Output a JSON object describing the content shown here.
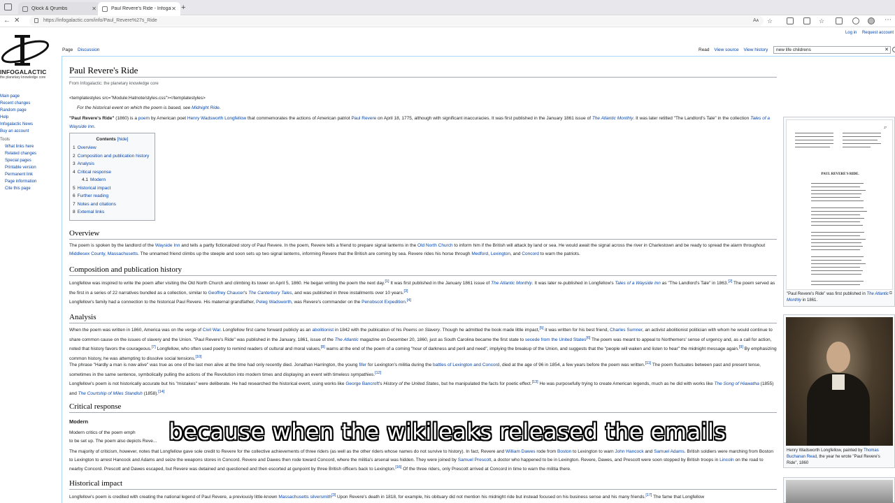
{
  "browser": {
    "tabs": [
      {
        "title": "Qlock & Qrumbs",
        "close": "✕"
      },
      {
        "title": "Paul Revere's Ride - Infogalactic",
        "close": "✕"
      }
    ],
    "new_tab": "+",
    "url": "https://infogalactic.com/info/Paul_Revere%27s_Ride",
    "reader_label": "Aᴀ"
  },
  "site": {
    "logo_text": "INFOGALACTIC",
    "logo_tagline": "the planetary knowledge core",
    "user_links": [
      "Log in",
      "Request account"
    ],
    "page_tabs": [
      "Page",
      "Discussion"
    ],
    "actions": [
      "Read",
      "View source",
      "View history"
    ],
    "search_value": "new life childrens",
    "sidebar": {
      "nav": [
        "Main page",
        "Recent changes",
        "Random page",
        "Help",
        "Infogalactic News",
        "Buy an account"
      ],
      "tools_heading": "Tools",
      "tools": [
        "What links here",
        "Related changes",
        "Special pages",
        "Printable version",
        "Permanent link",
        "Page information",
        "Cite this page"
      ]
    }
  },
  "article": {
    "title": "Paul Revere's Ride",
    "from": "From Infogalactic: the planetary knowledge core",
    "templatestyles": "<templatestyles src=\"Module:Hatnote/styles.css\"></templatestyles>",
    "hatnote": {
      "prefix": "For the historical event on which the poem is based, see ",
      "link": "Midnight Ride",
      "suffix": "."
    },
    "intro": {
      "t1": "\"Paul Revere's Ride\"",
      "t2": " (1860) is a ",
      "l1": "poem",
      "t3": " by American poet ",
      "l2": "Henry Wadsworth Longfellow",
      "t4": " that commemorates the actions of American patriot ",
      "l3": "Paul Revere",
      "t5": " on April 18, 1775, although with significant inaccuracies. It was first published in the January 1861 issue of ",
      "l4": "The Atlantic Monthly",
      "t6": ". It was later retitled \"The Landlord's Tale\" in the collection ",
      "l5": "Tales of a Wayside Inn",
      "t7": "."
    },
    "toc": {
      "title": "Contents",
      "hide": "[hide]",
      "items": [
        {
          "num": "1",
          "label": "Overview"
        },
        {
          "num": "2",
          "label": "Composition and publication history"
        },
        {
          "num": "3",
          "label": "Analysis"
        },
        {
          "num": "4",
          "label": "Critical response"
        },
        {
          "num": "4.1",
          "label": "Modern"
        },
        {
          "num": "5",
          "label": "Historical impact"
        },
        {
          "num": "6",
          "label": "Further reading"
        },
        {
          "num": "7",
          "label": "Notes and citations"
        },
        {
          "num": "8",
          "label": "External links"
        }
      ]
    },
    "overview": {
      "heading": "Overview",
      "t1": "The poem is spoken by the landlord of the ",
      "l1": "Wayside Inn",
      "t2": " and tells a partly fictionalized story of Paul Revere. In the poem, Revere tells a friend to prepare signal lanterns in the ",
      "l2": "Old North Church",
      "t3": " to inform him if the British will attack by land or sea. He would await the signal across the river in Charlestown and be ready to spread the alarm throughout ",
      "l3": "Middlesex County, Massachusetts",
      "t4": ". The unnamed friend climbs up the steeple and soon sets up two signal lanterns, informing Revere that the British are coming by sea. Revere rides his horse through ",
      "l4": "Medford",
      "t5": ", ",
      "l5": "Lexington",
      "t6": ", and ",
      "l6": "Concord",
      "t7": " to warn the patriots."
    },
    "composition": {
      "heading": "Composition and publication history",
      "p1": {
        "t1": "Longfellow was inspired to write the poem after visiting the Old North Church and climbing its tower on April 5, 1860. He began writing the poem the next day.",
        "r1": "[1]",
        "t2": " It was first published in the January 1861 issue of ",
        "l1": "The Atlantic Monthly",
        "t3": ". It was later re-published in Longfellow's ",
        "l2": "Tales of a Wayside Inn",
        "t4": " as \"The Landlord's Tale\" in 1863.",
        "r2": "[2]",
        "t5": " The poem served as the first in a series of 22 narratives bundled as a collection, similar to ",
        "l3": "Geoffrey Chaucer",
        "t6": "'s ",
        "l4": "The Canterbury Tales",
        "t7": ", and was published in three installments over 10 years.",
        "r3": "[3]"
      },
      "p2": {
        "t1": "Longfellow's family had a connection to the historical Paul Revere. His maternal grandfather, ",
        "l1": "Peleg Wadsworth",
        "t2": ", was Revere's commander on the ",
        "l2": "Penobscot Expedition",
        "t3": ".",
        "r1": "[4]"
      }
    },
    "analysis": {
      "heading": "Analysis",
      "p1": {
        "t1": "When the poem was written in 1860, America was on the verge of ",
        "l1": "Civil War",
        "t2": ". Longfellow first came forward publicly as an ",
        "l2": "abolitionist",
        "t3": " in 1842 with the publication of his ",
        "i1": "Poems on Slavery",
        "t4": ". Though he admitted the book made little impact,",
        "r1": "[5]",
        "t5": " it was written for his best friend, ",
        "l3": "Charles Sumner",
        "t6": ", an activist abolitionist politician with whom he would continue to share common cause on the issues of slavery and the Union. \"Paul Revere's Ride\" was published in the January, 1861, issue of the ",
        "l4": "The Atlantic",
        "t7": " magazine on December 20, 1860, just as South Carolina became the first state to ",
        "l5": "secede from the United States",
        "r2": "[6]",
        "t8": " The poem was meant to appeal to Northerners' sense of urgency and, as a call for action, noted that history favors the courageous.",
        "r3": "[7]",
        "t9": " Longfellow, who often used poetry to remind readers of cultural and moral values,",
        "r4": "[8]",
        "t10": " warns at the end of the poem of a coming \"hour of darkness and peril and need\", implying the breakup of the Union, and suggests that the \"people will waken and listen to hear\" the midnight message again.",
        "r5": "[9]",
        "t11": " By emphasizing common history, he was attempting to dissolve social tensions.",
        "r6": "[10]"
      },
      "p2": {
        "t1": "The phrase \"Hardly a man is now alive\" was true as one of the last men alive at the time had only recently died. Jonathan Harrington, the young ",
        "l1": "fifer",
        "t2": " for Lexington's militia during the ",
        "l2": "battles of Lexington and Concord",
        "t3": ", died at the age of 96 in 1854, a few years before the poem was written.",
        "r1": "[11]",
        "t4": " The poem fluctuates between past and present tense, sometimes in the same sentence, symbolically pulling the actions of the Revolution into modern times and displaying an event with timeless sympathies.",
        "r2": "[12]"
      },
      "p3": {
        "t1": "Longfellow's poem is not historically accurate but his \"mistakes\" were deliberate. He had researched the historical event, using works like ",
        "l1": "George Bancroft",
        "t2": "'s ",
        "i1": "History of the United States",
        "t3": ", but he manipulated the facts for poetic effect.",
        "r1": "[13]",
        "t4": " He was purposefully trying to create American legends, much as he did with works like ",
        "l2": "The Song of Hiawatha",
        "t5": " (1855) and ",
        "l3": "The Courtship of Miles Standish",
        "t6": " (1858).",
        "r2": "[14]"
      }
    },
    "critical": {
      "heading": "Critical response",
      "subheading": "Modern",
      "p1": {
        "t1": "Modern critics of the poem emph",
        "t2": "to be set up. The poem also depicts Reve",
        "t3": "..."
      },
      "p2": {
        "t1": "The majority of criticism, however, notes that Longfellow gave sole credit to Revere for the collective achievements of three riders (as well as the other riders whose names do not survive to history). In fact, Revere and ",
        "l1": "William Dawes",
        "t2": " rode from ",
        "l2": "Boston",
        "t3": " to Lexington to warn ",
        "l3": "John Hancock",
        "t4": " and ",
        "l4": "Samuel Adams",
        "t5": ". British soldiers were marching from Boston to Lexington to arrest Hancock and Adams and seize the weapons stores in Concord. Revere and Dawes then rode toward Concord, where the militia's arsenal was hidden. They were joined by ",
        "l5": "Samuel Prescott",
        "t6": ", a doctor who happened to be in Lexington. Revere, Dawes, and Prescott were soon stopped by British troops in ",
        "l6": "Lincoln",
        "t7": " on the road to nearby Concord. Prescott and Dawes escaped, but Revere was detained and questioned and then escorted at gunpoint by three British officers back to Lexington.",
        "r1": "[16]",
        "t8": " Of the three riders, only Prescott arrived at Concord in time to warn the militia there."
      }
    },
    "historical": {
      "heading": "Historical impact",
      "t1": "Longfellow's poem is credited with creating the national legend of Paul Revere, a previously little-known ",
      "l1": "Massachusetts silversmith",
      "r1": "[3]",
      "t2": " Upon Revere's death in 1818, for example, his obituary did not mention his midnight ride but instead focused on his business sense and his many friends.",
      "r2": "[17]",
      "t3": " The fame that Longfellow"
    },
    "figures": {
      "fig1_caption_t1": "\"Paul Revere's Ride\" was first published in ",
      "fig1_caption_l1": "The Atlantic Monthly",
      "fig1_caption_t2": " in 1861.",
      "fig1_heading": "PAUL REVERE'S RIDE.",
      "fig1_page": "27",
      "fig2_caption_t1": "Henry Wadsworth Longfellow, painted by ",
      "fig2_caption_l1": "Thomas Buchanan Read",
      "fig2_caption_t2": ", the year he wrote \"Paul Revere's Ride\", 1860"
    }
  },
  "subtitle": "because when the wikileaks released the emails"
}
